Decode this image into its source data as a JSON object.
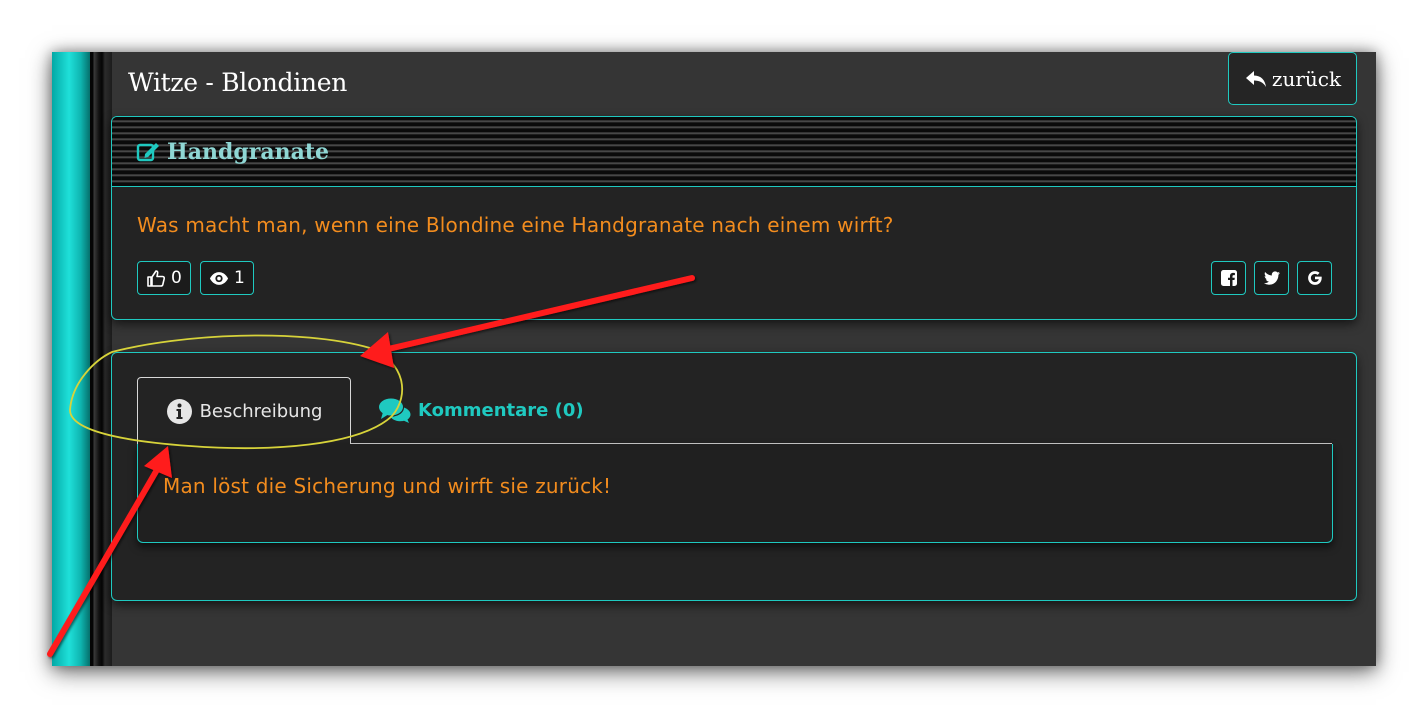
{
  "page": {
    "title": "Witze - Blondinen",
    "back_label": "zurück"
  },
  "joke": {
    "title": "Handgranate",
    "question": "Was macht man, wenn eine Blondine eine Handgranate nach einem wirft?",
    "likes": "0",
    "views": "1",
    "share_icons": [
      "facebook-icon",
      "twitter-icon",
      "google-icon"
    ]
  },
  "tabs": {
    "description_label": "Beschreibung",
    "comments_label": "Kommentare (0)",
    "active": "Beschreibung",
    "answer": "Man löst die Sicherung und wirft sie zurück!"
  },
  "colors": {
    "accent": "#1fc9c0",
    "orange_text": "#f28c1e",
    "panel_bg": "#232323",
    "page_bg": "#353535",
    "annotation_red": "#ff1a1a",
    "annotation_yellow": "#d7d33a"
  }
}
